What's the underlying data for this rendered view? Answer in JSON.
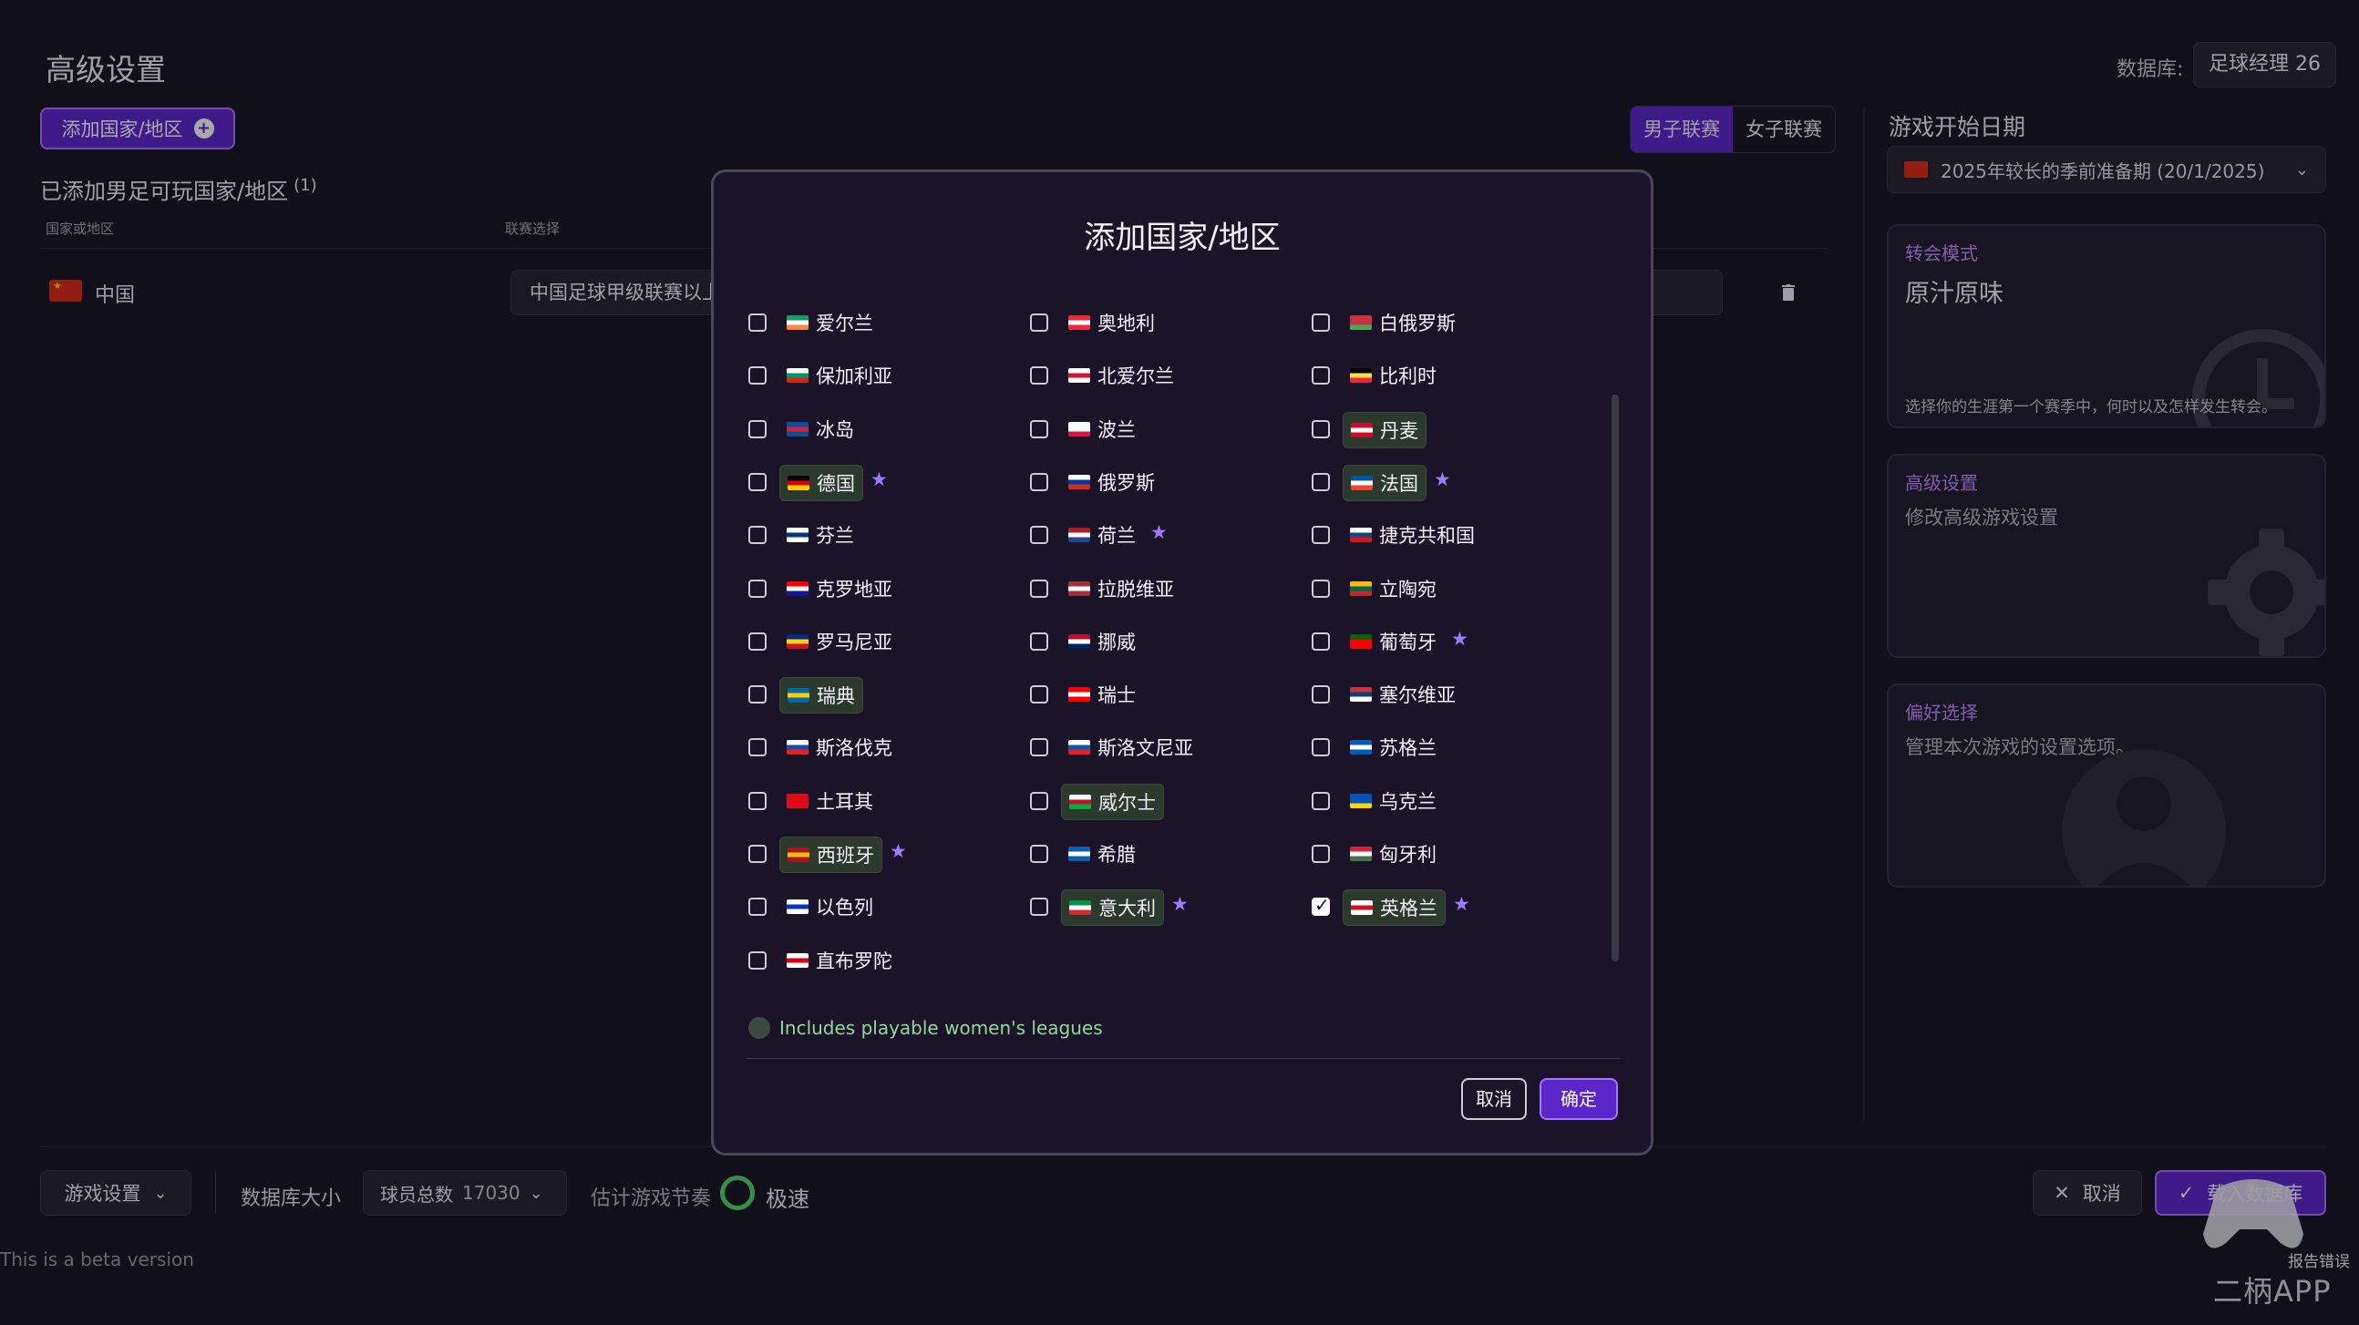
{
  "page": {
    "title": "高级设置",
    "database_label": "数据库:",
    "database_value": "足球经理 26",
    "add_button": "添加国家/地区",
    "league_tabs": [
      "男子联赛",
      "女子联赛"
    ],
    "added_title": "已添加男足可玩国家/地区",
    "added_count": "(1)",
    "col_country": "国家或地区",
    "col_league": "联赛选择",
    "rows": [
      {
        "country": "中国",
        "league": "中国足球甲级联赛以上",
        "flag_color": "#de2910"
      }
    ]
  },
  "right_panel": {
    "start_date_label": "游戏开始日期",
    "start_date_value": "2025年较长的季前准备期 (20/1/2025)",
    "cards": [
      {
        "title": "转会模式",
        "main": "原汁原味",
        "desc": "选择你的生涯第一个赛季中，何时以及怎样发生转会。",
        "icon": "clock-icon"
      },
      {
        "title": "高级设置",
        "sub": "修改高级游戏设置",
        "icon": "gear-icon"
      },
      {
        "title": "偏好选择",
        "sub": "管理本次游戏的设置选项。",
        "icon": "user-icon"
      }
    ]
  },
  "bottom": {
    "game_settings": "游戏设置",
    "db_size_label": "数据库大小",
    "players_label": "球员总数",
    "players_value": "17030",
    "pace_label": "估计游戏节奏",
    "pace_value": "极速",
    "pace_color": "#4cd964",
    "cancel": "取消",
    "load": "载入数据库",
    "beta": "This is a beta version",
    "report": "报告错误",
    "watermark": "二柄APP"
  },
  "modal": {
    "title": "添加国家/地区",
    "countries": [
      {
        "name": "爱尔兰",
        "flag": [
          "#169b62",
          "#ffffff",
          "#ff883e"
        ],
        "checked": false,
        "star": false,
        "pill": false
      },
      {
        "name": "奥地利",
        "flag": [
          "#ed2939",
          "#ffffff",
          "#ed2939"
        ],
        "checked": false,
        "star": false,
        "pill": false
      },
      {
        "name": "白俄罗斯",
        "flag": [
          "#c8313e",
          "#c8313e",
          "#4aa657"
        ],
        "checked": false,
        "star": false,
        "pill": false
      },
      {
        "name": "保加利亚",
        "flag": [
          "#ffffff",
          "#00966e",
          "#d62612"
        ],
        "checked": false,
        "star": false,
        "pill": false
      },
      {
        "name": "北爱尔兰",
        "flag": [
          "#ffffff",
          "#cf142b",
          "#ffffff"
        ],
        "checked": false,
        "star": false,
        "pill": false
      },
      {
        "name": "比利时",
        "flag": [
          "#000000",
          "#fae042",
          "#ed2939"
        ],
        "checked": false,
        "star": false,
        "pill": false
      },
      {
        "name": "冰岛",
        "flag": [
          "#02529c",
          "#dc1e35",
          "#02529c"
        ],
        "checked": false,
        "star": false,
        "pill": false
      },
      {
        "name": "波兰",
        "flag": [
          "#ffffff",
          "#ffffff",
          "#dc143c"
        ],
        "checked": false,
        "star": false,
        "pill": false
      },
      {
        "name": "丹麦",
        "flag": [
          "#c8102e",
          "#ffffff",
          "#c8102e"
        ],
        "checked": false,
        "star": false,
        "pill": true
      },
      {
        "name": "德国",
        "flag": [
          "#000000",
          "#dd0000",
          "#ffce00"
        ],
        "checked": false,
        "star": true,
        "pill": true
      },
      {
        "name": "俄罗斯",
        "flag": [
          "#ffffff",
          "#0039a6",
          "#d52b1e"
        ],
        "checked": false,
        "star": false,
        "pill": false
      },
      {
        "name": "法国",
        "flag": [
          "#0055a4",
          "#ffffff",
          "#ef4135"
        ],
        "checked": false,
        "star": true,
        "pill": true
      },
      {
        "name": "芬兰",
        "flag": [
          "#ffffff",
          "#003580",
          "#ffffff"
        ],
        "checked": false,
        "star": false,
        "pill": false
      },
      {
        "name": "荷兰",
        "flag": [
          "#ae1c28",
          "#ffffff",
          "#21468b"
        ],
        "checked": false,
        "star": true,
        "pill": false
      },
      {
        "name": "捷克共和国",
        "flag": [
          "#ffffff",
          "#11457e",
          "#d7141a"
        ],
        "checked": false,
        "star": false,
        "pill": false
      },
      {
        "name": "克罗地亚",
        "flag": [
          "#ff0000",
          "#ffffff",
          "#171796"
        ],
        "checked": false,
        "star": false,
        "pill": false
      },
      {
        "name": "拉脱维亚",
        "flag": [
          "#9e3039",
          "#ffffff",
          "#9e3039"
        ],
        "checked": false,
        "star": false,
        "pill": false
      },
      {
        "name": "立陶宛",
        "flag": [
          "#fdb913",
          "#006a44",
          "#c1272d"
        ],
        "checked": false,
        "star": false,
        "pill": false
      },
      {
        "name": "罗马尼亚",
        "flag": [
          "#002b7f",
          "#fcd116",
          "#ce1126"
        ],
        "checked": false,
        "star": false,
        "pill": false
      },
      {
        "name": "挪威",
        "flag": [
          "#ba0c2f",
          "#ffffff",
          "#00205b"
        ],
        "checked": false,
        "star": false,
        "pill": false
      },
      {
        "name": "葡萄牙",
        "flag": [
          "#006600",
          "#ff0000",
          "#ff0000"
        ],
        "checked": false,
        "star": true,
        "pill": false
      },
      {
        "name": "瑞典",
        "flag": [
          "#006aa7",
          "#fecc00",
          "#006aa7"
        ],
        "checked": false,
        "star": false,
        "pill": true
      },
      {
        "name": "瑞士",
        "flag": [
          "#ff0000",
          "#ffffff",
          "#ff0000"
        ],
        "checked": false,
        "star": false,
        "pill": false
      },
      {
        "name": "塞尔维亚",
        "flag": [
          "#c6363c",
          "#0c4076",
          "#ffffff"
        ],
        "checked": false,
        "star": false,
        "pill": false
      },
      {
        "name": "斯洛伐克",
        "flag": [
          "#ffffff",
          "#0b4ea2",
          "#ee1c25"
        ],
        "checked": false,
        "star": false,
        "pill": false
      },
      {
        "name": "斯洛文尼亚",
        "flag": [
          "#ffffff",
          "#005da4",
          "#ed1c24"
        ],
        "checked": false,
        "star": false,
        "pill": false
      },
      {
        "name": "苏格兰",
        "flag": [
          "#005eb8",
          "#ffffff",
          "#005eb8"
        ],
        "checked": false,
        "star": false,
        "pill": false
      },
      {
        "name": "土耳其",
        "flag": [
          "#e30a17",
          "#e30a17",
          "#e30a17"
        ],
        "checked": false,
        "star": false,
        "pill": false
      },
      {
        "name": "威尔士",
        "flag": [
          "#ffffff",
          "#c8102e",
          "#00b140"
        ],
        "checked": false,
        "star": false,
        "pill": true
      },
      {
        "name": "乌克兰",
        "flag": [
          "#0057b7",
          "#0057b7",
          "#ffd700"
        ],
        "checked": false,
        "star": false,
        "pill": false
      },
      {
        "name": "西班牙",
        "flag": [
          "#aa151b",
          "#f1bf00",
          "#aa151b"
        ],
        "checked": false,
        "star": true,
        "pill": true
      },
      {
        "name": "希腊",
        "flag": [
          "#0d5eaf",
          "#ffffff",
          "#0d5eaf"
        ],
        "checked": false,
        "star": false,
        "pill": false
      },
      {
        "name": "匈牙利",
        "flag": [
          "#ce2939",
          "#ffffff",
          "#477050"
        ],
        "checked": false,
        "star": false,
        "pill": false
      },
      {
        "name": "以色列",
        "flag": [
          "#ffffff",
          "#0038b8",
          "#ffffff"
        ],
        "checked": false,
        "star": false,
        "pill": false
      },
      {
        "name": "意大利",
        "flag": [
          "#009246",
          "#ffffff",
          "#ce2b37"
        ],
        "checked": false,
        "star": true,
        "pill": true
      },
      {
        "name": "英格兰",
        "flag": [
          "#ffffff",
          "#ce1124",
          "#ffffff"
        ],
        "checked": true,
        "star": true,
        "pill": true
      },
      {
        "name": "直布罗陀",
        "flag": [
          "#ffffff",
          "#da000c",
          "#ffffff"
        ],
        "checked": false,
        "star": false,
        "pill": false
      }
    ],
    "womens_label": "Includes playable women's leagues",
    "cancel": "取消",
    "ok": "确定"
  }
}
